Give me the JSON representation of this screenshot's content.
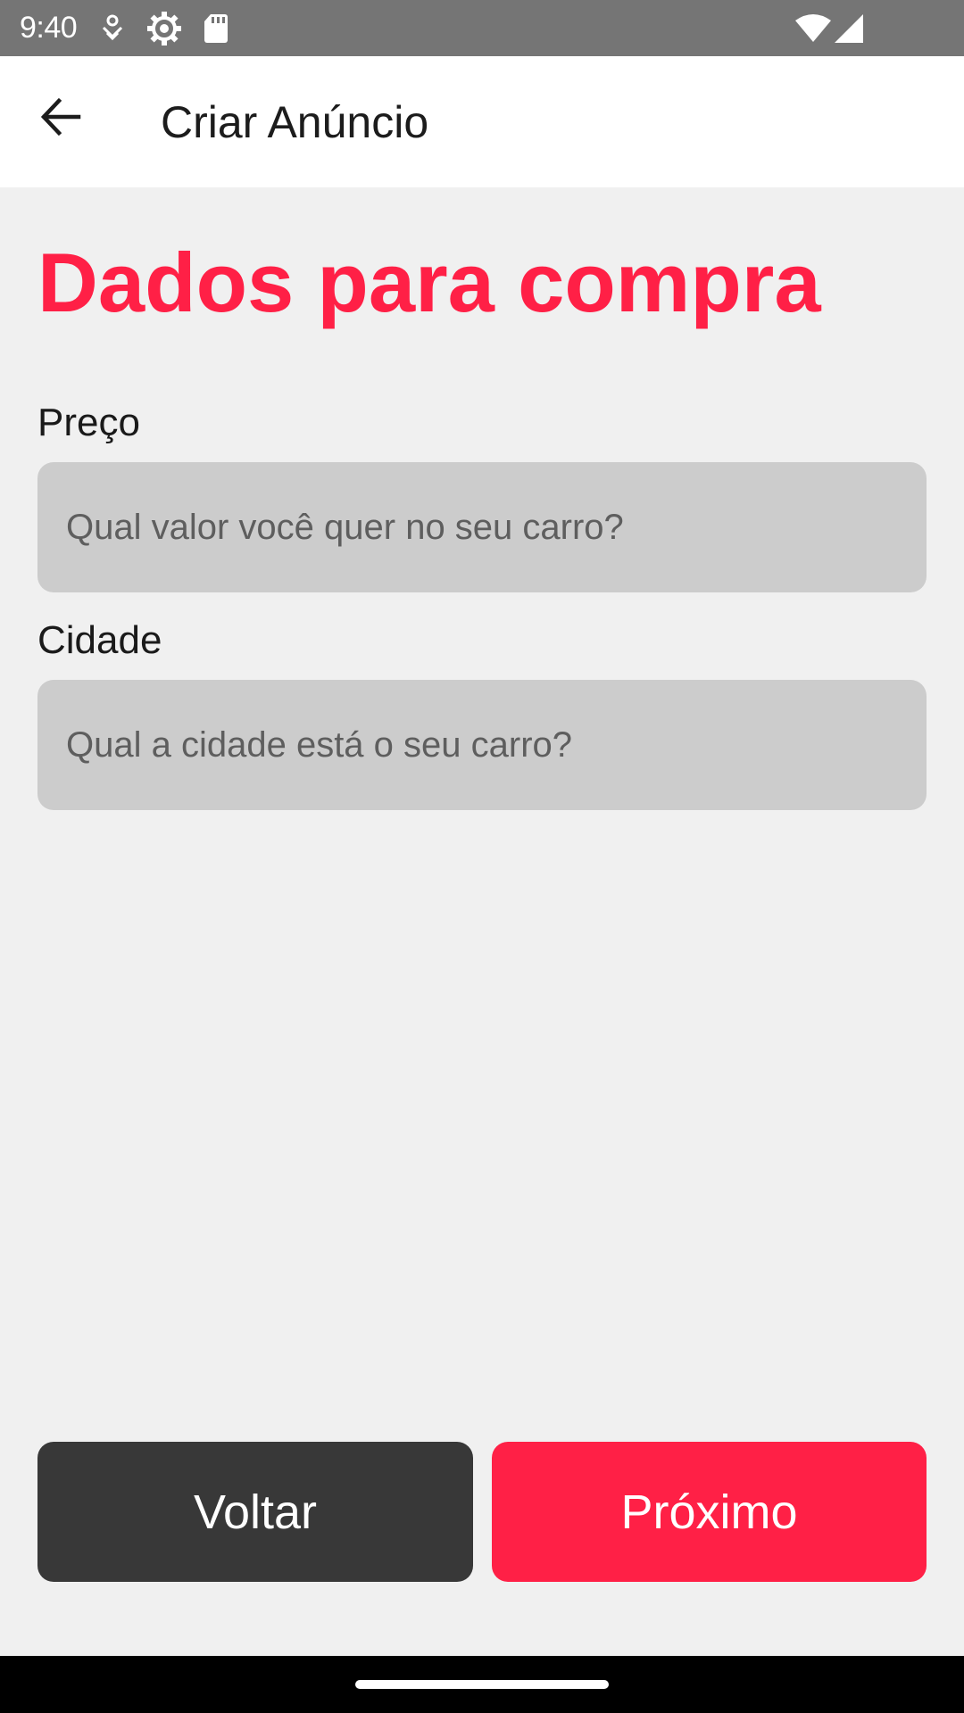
{
  "status_bar": {
    "time": "9:40",
    "icons": [
      "usb-debug-icon",
      "settings-gear-icon",
      "sd-card-icon",
      "wifi-icon",
      "cell-signal-icon"
    ]
  },
  "app_bar": {
    "back_icon": "arrow-back-icon",
    "title": "Criar Anúncio"
  },
  "form": {
    "heading": "Dados para compra",
    "price": {
      "label": "Preço",
      "placeholder": "Qual valor você quer no seu carro?",
      "value": ""
    },
    "city": {
      "label": "Cidade",
      "placeholder": "Qual a cidade está o seu carro?",
      "value": ""
    }
  },
  "actions": {
    "back_label": "Voltar",
    "next_label": "Próximo"
  },
  "colors": {
    "accent": "#ff2046",
    "dark_button": "#383838",
    "input_bg": "#cccccc",
    "page_bg": "#f0f0f0",
    "status_bar": "#757575"
  }
}
